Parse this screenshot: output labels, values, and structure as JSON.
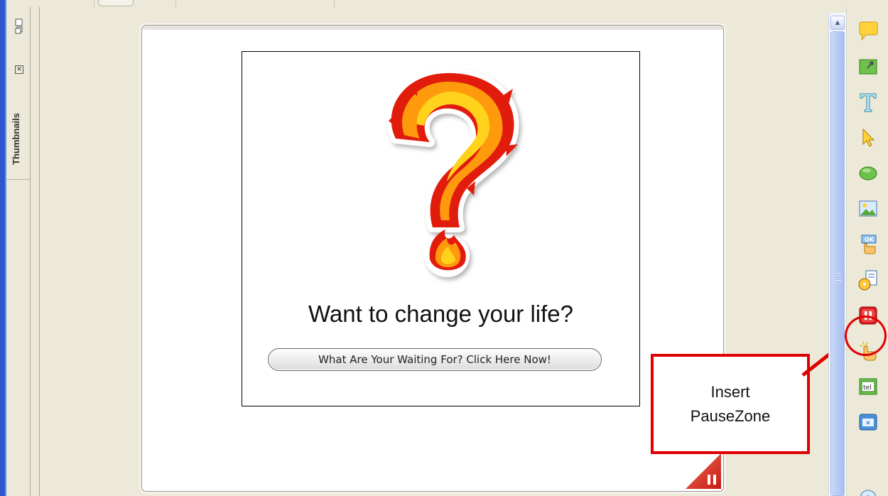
{
  "thumbnails_panel": {
    "label": "Thumbnails",
    "close_glyph": "✕"
  },
  "slide": {
    "headline": "Want to change your life?",
    "cta_button": "What Are Your Waiting For? Click Here Now!",
    "image": "flaming-question-mark"
  },
  "callout": {
    "line1": "Insert",
    "line2": "PauseZone",
    "border_color": "#e00000"
  },
  "toolbar": {
    "tools": [
      {
        "name": "speech-bubble-icon",
        "label": "Callout"
      },
      {
        "name": "image-box-icon",
        "label": "Highlight"
      },
      {
        "name": "text-icon",
        "label": "Text"
      },
      {
        "name": "cursor-icon",
        "label": "Cursor"
      },
      {
        "name": "shape-icon",
        "label": "Shape"
      },
      {
        "name": "picture-icon",
        "label": "Image"
      },
      {
        "name": "ok-button-icon",
        "label": "Button"
      },
      {
        "name": "media-icon",
        "label": "Media"
      },
      {
        "name": "pausezone-icon",
        "label": "PauseZone"
      },
      {
        "name": "hand-click-icon",
        "label": "Hotspot"
      },
      {
        "name": "text-entry-icon",
        "label": "tel"
      },
      {
        "name": "window-icon",
        "label": "Window"
      },
      {
        "name": "link-icon",
        "label": "Link"
      }
    ]
  },
  "scrollbar": {
    "up_glyph": "▲"
  },
  "colors": {
    "window_bg": "#ece9d8",
    "accent_red": "#e00000",
    "xp_blue": "#2f58d0"
  }
}
